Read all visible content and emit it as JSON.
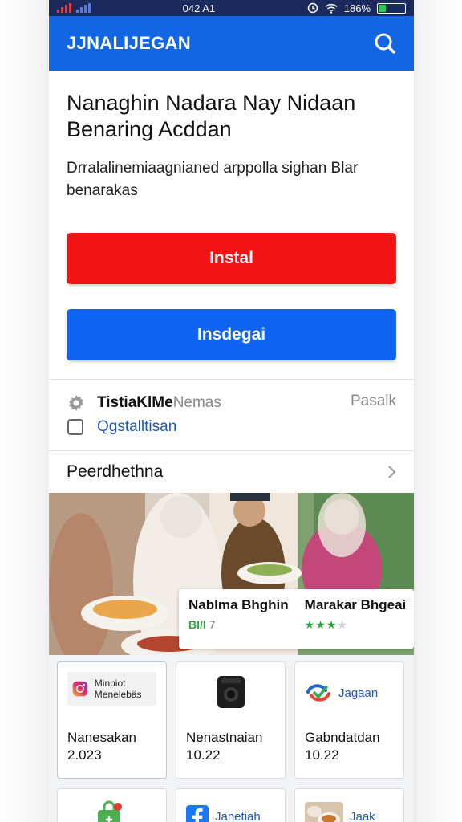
{
  "status_bar": {
    "time": "042 A1",
    "battery_text": "186%",
    "battery_level": 0.25
  },
  "header": {
    "title": "JJNALIJEGAN"
  },
  "hero": {
    "title": "Nanaghin Nadara Nay Nidaan Benaring Acddan",
    "description": "Drralalinemiaagnianed arppolla sighan Blar benarakas",
    "primary_button": "Instal",
    "secondary_button": "Insdegai"
  },
  "info": {
    "name": "TistiaKlMe",
    "sub": "Nemas",
    "link": "Qgstalltisan",
    "right_label": "Pasalk"
  },
  "section": {
    "label": "Peerdhethna"
  },
  "banner_card": {
    "left": {
      "title": "Nablma Bhghin",
      "tag": "Bl/l",
      "count": "7"
    },
    "right": {
      "title": "Marakar Bhgeai",
      "rating": 3,
      "rating_max": 4
    }
  },
  "tiles": [
    {
      "badge": "Minpiot Menelebäs",
      "name": "Nanesakan",
      "value": "2.023",
      "icon": "instagram-icon"
    },
    {
      "name": "Nenastnaian",
      "value": "10.22",
      "icon": "camera-icon"
    },
    {
      "brand": "Jagaan",
      "name": "Gabndatdan",
      "value": "10.22",
      "icon": "swirl-logo-icon"
    },
    {
      "icon": "bag-icon"
    },
    {
      "brand": "Janetiah",
      "icon": "facebook-icon"
    },
    {
      "brand": "Jaak",
      "icon": "food-photo-icon"
    }
  ],
  "colors": {
    "header_blue": "#1266e3",
    "install_red": "#f21414",
    "secondary_blue": "#0e63f2",
    "status_bar": "#1b2a5c"
  }
}
